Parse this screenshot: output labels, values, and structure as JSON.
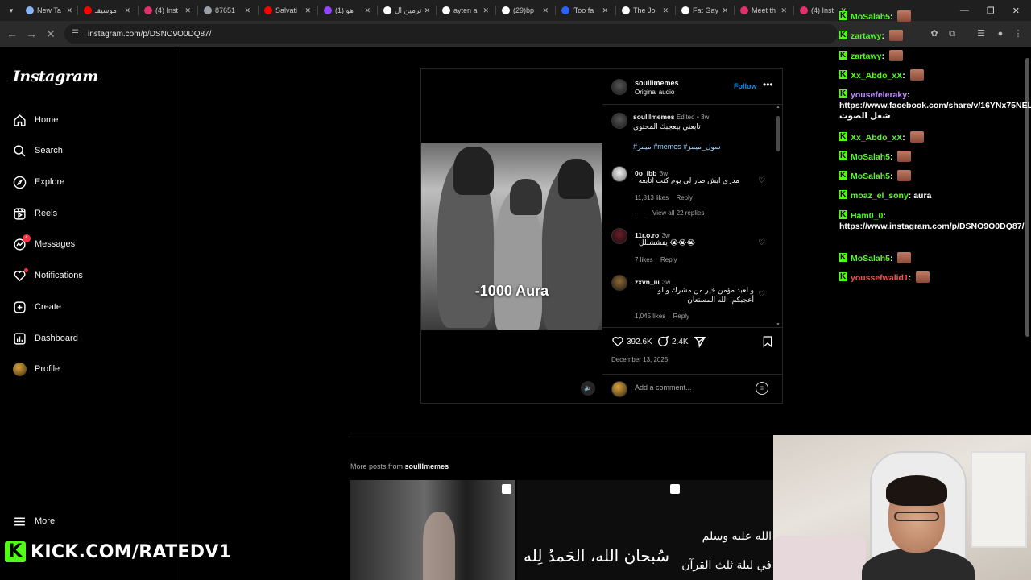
{
  "browser": {
    "tabs": [
      {
        "title": "New Ta",
        "color": "#8ab4f8"
      },
      {
        "title": "موسيقـ",
        "color": "#ff0000"
      },
      {
        "title": "(4) Inst",
        "color": "#e1306c"
      },
      {
        "title": "87651",
        "color": "#9aa0a6"
      },
      {
        "title": "Salvati",
        "color": "#ff0000"
      },
      {
        "title": "(1) هو",
        "color": "#9146ff"
      },
      {
        "title": "ترمين ال",
        "color": "#ffffff"
      },
      {
        "title": "ayten a",
        "color": "#ffffff"
      },
      {
        "title": "(29)bp",
        "color": "#ffffff"
      },
      {
        "title": "'Too fa",
        "color": "#2962ff"
      },
      {
        "title": "The Jo",
        "color": "#ffffff"
      },
      {
        "title": "Fat Gay",
        "color": "#ffffff"
      },
      {
        "title": "Meet th",
        "color": "#e1306c"
      },
      {
        "title": "(4) Inst",
        "color": "#e1306c"
      }
    ],
    "url": "instagram.com/p/DSNO9O0DQ87/"
  },
  "instagram": {
    "logo": "Instagram",
    "nav": [
      {
        "label": "Home",
        "icon": "home-icon"
      },
      {
        "label": "Search",
        "icon": "search-icon"
      },
      {
        "label": "Explore",
        "icon": "explore-icon"
      },
      {
        "label": "Reels",
        "icon": "reels-icon"
      },
      {
        "label": "Messages",
        "icon": "messages-icon",
        "badge": "4"
      },
      {
        "label": "Notifications",
        "icon": "heart-icon"
      },
      {
        "label": "Create",
        "icon": "create-icon"
      },
      {
        "label": "Dashboard",
        "icon": "dashboard-icon"
      },
      {
        "label": "Profile",
        "icon": "avatar"
      }
    ],
    "more_label": "More",
    "post": {
      "overlay_text": "-1000 Aura",
      "author": "soulllmemes",
      "audio": "Original audio",
      "follow_label": "Follow",
      "caption": {
        "user": "soulllmemes",
        "edited": "Edited",
        "age": "3w",
        "text": "تابعني بيعجبك المحتوى",
        "hashtags": "#ميمز #memes #سول_ميمز"
      },
      "comments": [
        {
          "user": "0o_ibb",
          "age": "3w",
          "text": "مدري ايش صار لي يوم كنت اتابعه",
          "likes": "11,813 likes",
          "reply": "Reply",
          "view_replies": "View all 22 replies"
        },
        {
          "user": "11r.o.ro",
          "age": "3w",
          "text": "😭😭😭 يفششللل",
          "likes": "7 likes",
          "reply": "Reply"
        },
        {
          "user": "zxvn_iii",
          "age": "3w",
          "text": "و لعبد مؤمن خير من مشرك و لو أعجبكم. الله المستعان",
          "likes": "1,045 likes",
          "reply": "Reply"
        }
      ],
      "like_count": "392.6K",
      "comment_count": "2.4K",
      "date": "December 13, 2025",
      "add_comment_placeholder": "Add a comment..."
    },
    "more_posts": {
      "prefix": "More posts from",
      "user": "soulllmemes"
    },
    "grid_texts": {
      "line1": "الله عليه وسلم",
      "line2": "سُبحان الله، الحَمدُ لِله",
      "line3": "في ليلة ثلث القرآن"
    }
  },
  "stream": {
    "kick_url": "KICK.COM/RATEDV1",
    "chat": [
      {
        "user": "MoSalah5",
        "color": "#53fc18",
        "text": "",
        "emote": true
      },
      {
        "user": "zartawy",
        "color": "#53fc18",
        "text": "",
        "emote": true
      },
      {
        "user": "zartawy",
        "color": "#53fc18",
        "text": "",
        "emote": true
      },
      {
        "user": "Xx_Abdo_xX",
        "color": "#53fc18",
        "text": "",
        "emote": true
      },
      {
        "user": "yousefeleraky",
        "color": "#c18cff",
        "text": "https://www.facebook.com/share/v/16YNx75NEL/ شغل الصوت",
        "emote": false
      },
      {
        "user": "Xx_Abdo_xX",
        "color": "#53fc18",
        "text": "",
        "emote": true
      },
      {
        "user": "MoSalah5",
        "color": "#53fc18",
        "text": "",
        "emote": true
      },
      {
        "user": "MoSalah5",
        "color": "#53fc18",
        "text": "",
        "emote": true
      },
      {
        "user": "moaz_el_sony",
        "color": "#53fc18",
        "text": "aura",
        "emote": false
      },
      {
        "user": "Ham0_0",
        "color": "#53fc18",
        "text": "https://www.instagram.com/p/DSNO9O0DQ87/",
        "emote": false
      },
      {
        "user": "MoSalah5",
        "color": "#53fc18",
        "text": "",
        "emote": true
      },
      {
        "user": "youssefwalid1",
        "color": "#ff4b4b",
        "text": "",
        "emote": true
      }
    ]
  }
}
